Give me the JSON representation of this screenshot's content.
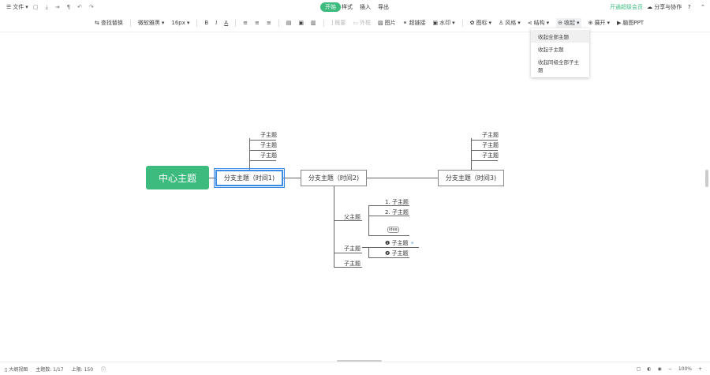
{
  "topbar": {
    "file": "文件",
    "tabs": [
      "开始",
      "样式",
      "插入",
      "导出"
    ],
    "vip": "开通超级会员",
    "share": "分享与协作",
    "help": "?"
  },
  "toolbar": [
    "查找替换",
    "微软雅黑",
    "16px",
    "B",
    "I",
    "A",
    "概要",
    "外框",
    "图片",
    "超链接",
    "水印",
    "图标",
    "风格",
    "结构",
    "收起",
    "展开",
    "脑图PPT"
  ],
  "collapse_menu": [
    "收起全部主题",
    "收起子主题",
    "收起同级全部子主题"
  ],
  "map": {
    "center": "中心主题",
    "branch1": "分支主题（时间1)",
    "branch2": "分支主题（时间2)",
    "branch3": "分支主题（时间3)",
    "sub": "子主题",
    "parent": "父主题",
    "num1": "1. 子主题",
    "num2": "2. 子主题",
    "idea": "idea",
    "c1": "❶ 子主题",
    "c2": "❷ 子主题"
  },
  "status": {
    "outline": "大纲视图",
    "count": "主题数: 1/17",
    "limit": "上限: 150",
    "zoom": "100%"
  },
  "colors": {
    "accent": "#3dbb7f"
  }
}
